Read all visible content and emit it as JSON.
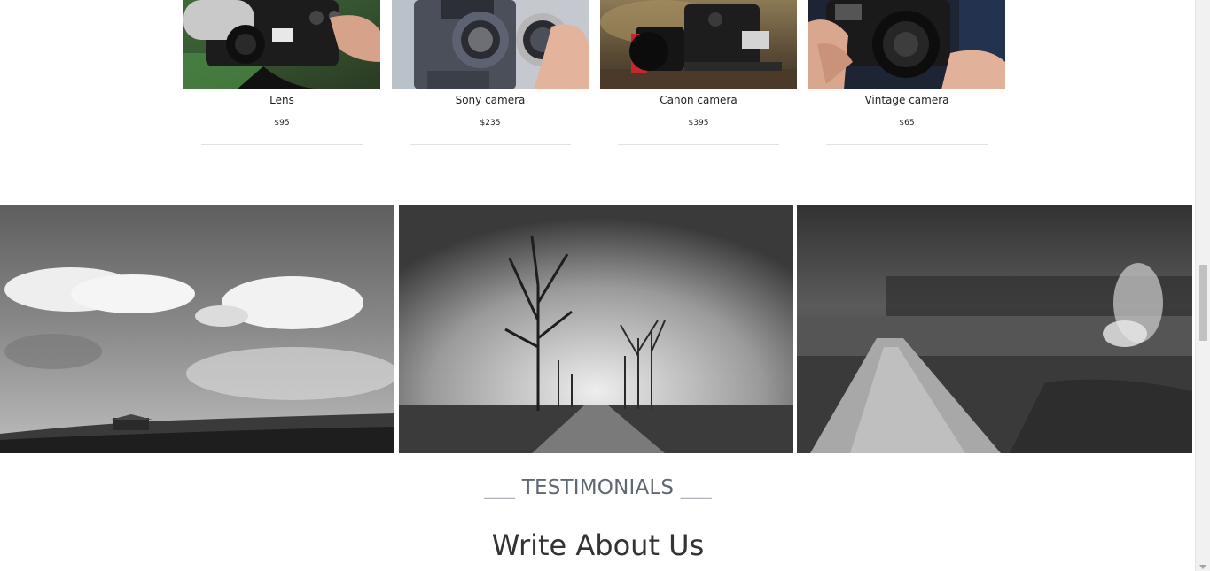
{
  "products": [
    {
      "name": "Lens",
      "price": "$95",
      "image_icon": "camera-lens-photo"
    },
    {
      "name": "Sony camera",
      "price": "$235",
      "image_icon": "sony-camera-photo"
    },
    {
      "name": "Canon camera",
      "price": "$395",
      "image_icon": "canon-camera-photo"
    },
    {
      "name": "Vintage camera",
      "price": "$65",
      "image_icon": "vintage-camera-photo"
    }
  ],
  "gallery": [
    {
      "image_icon": "clouds-landscape-photo"
    },
    {
      "image_icon": "foggy-tree-road-photo"
    },
    {
      "image_icon": "misty-path-field-photo"
    }
  ],
  "testimonials": {
    "label": "___ TESTIMONIALS ___",
    "title": "Write About Us"
  },
  "scrollbar": {
    "position_fraction": 0.46
  },
  "colors": {
    "label_color": "#5f6874",
    "title_color": "#333333",
    "divider_color": "#e2e2e2"
  }
}
